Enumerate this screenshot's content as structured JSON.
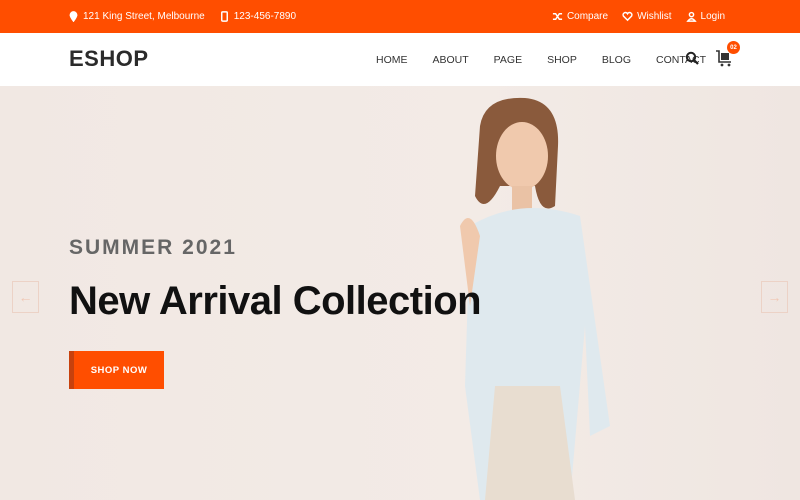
{
  "topbar": {
    "address": "121 King Street, Melbourne",
    "phone": "123-456-7890",
    "compare": "Compare",
    "wishlist": "Wishlist",
    "login": "Login"
  },
  "header": {
    "logo": "ESHOP",
    "nav": [
      "HOME",
      "ABOUT",
      "PAGE",
      "SHOP",
      "BLOG",
      "CONTACT"
    ],
    "cart_count": "02"
  },
  "hero": {
    "subtitle": "SUMMER 2021",
    "title": "New Arrival Collection",
    "cta": "SHOP NOW",
    "prev_arrow": "←",
    "next_arrow": "→"
  },
  "colors": {
    "accent": "#ff4e00",
    "dark": "#2b2b2b"
  }
}
